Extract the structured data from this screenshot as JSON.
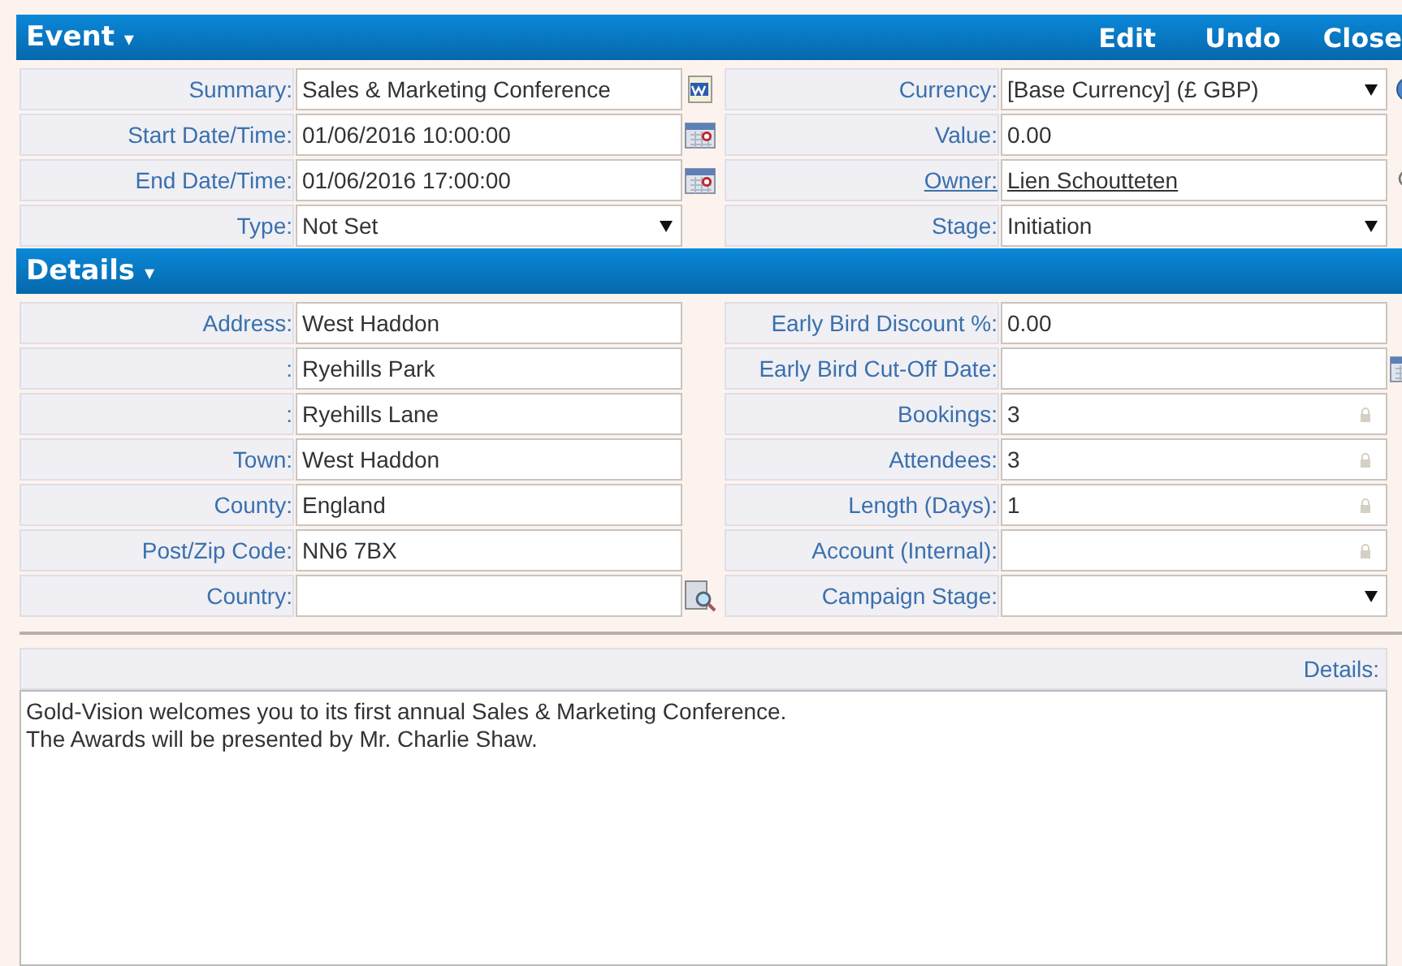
{
  "event_header": {
    "title": "Event",
    "caret": "▾",
    "actions": [
      "Edit",
      "Undo",
      "Close"
    ]
  },
  "event_fields": {
    "left": [
      {
        "label": "Summary:",
        "value": "Sales & Marketing Conference",
        "kind": "document"
      },
      {
        "label": "Start Date/Time:",
        "value": "01/06/2016 10:00:00",
        "kind": "date"
      },
      {
        "label": "End Date/Time:",
        "value": "01/06/2016 17:00:00",
        "kind": "date"
      },
      {
        "label": "Type:",
        "value": "Not Set",
        "kind": "select"
      }
    ],
    "right": [
      {
        "label": "Currency:",
        "value": "[Base Currency] (£ GBP)",
        "kind": "currency"
      },
      {
        "label": "Value:",
        "value": "0.00",
        "kind": "text"
      },
      {
        "label": "Owner:",
        "value": "Lien Schoutteten",
        "kind": "link"
      },
      {
        "label": "Stage:",
        "value": "Initiation",
        "kind": "select"
      }
    ]
  },
  "details_header": {
    "title": "Details",
    "caret": "▾"
  },
  "details_fields": {
    "left": [
      {
        "label": "Address:",
        "value": "West Haddon",
        "kind": "text"
      },
      {
        "label": ":",
        "value": "Ryehills Park",
        "kind": "text"
      },
      {
        "label": ":",
        "value": "Ryehills Lane",
        "kind": "text"
      },
      {
        "label": "Town:",
        "value": "West Haddon",
        "kind": "text"
      },
      {
        "label": "County:",
        "value": "England",
        "kind": "text"
      },
      {
        "label": "Post/Zip Code:",
        "value": "NN6 7BX",
        "kind": "text"
      },
      {
        "label": "Country:",
        "kind": "lookup"
      }
    ],
    "right": [
      {
        "label": "Early Bird Discount %:",
        "value": "0.00",
        "kind": "text"
      },
      {
        "label": "Early Bird Cut-Off Date:",
        "kind": "date"
      },
      {
        "label": "Bookings:",
        "value": "3",
        "kind": "locked"
      },
      {
        "label": "Attendees:",
        "value": "3",
        "kind": "locked"
      },
      {
        "label": "Length (Days):",
        "value": "1",
        "kind": "locked"
      },
      {
        "label": "Account (Internal):",
        "kind": "locked"
      },
      {
        "label": "Campaign Stage:",
        "kind": "select"
      }
    ]
  },
  "notes": {
    "label": "Details:",
    "text": "Gold-Vision welcomes you to its first annual Sales & Marketing Conference.\nThe Awards will be presented by Mr. Charlie Shaw."
  }
}
